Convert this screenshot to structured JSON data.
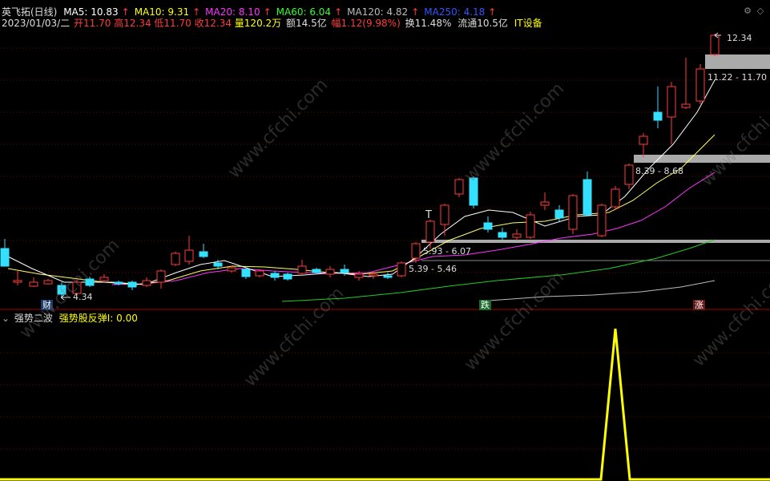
{
  "header": {
    "stock_name": "英飞拓(日线)",
    "ma": [
      {
        "label": "MA5: 10.83",
        "color": "#ffffff"
      },
      {
        "label": "MA10: 9.31",
        "color": "#ffff00"
      },
      {
        "label": "MA20: 8.10",
        "color": "#ff33ff"
      },
      {
        "label": "MA60: 6.04",
        "color": "#33ff33"
      },
      {
        "label": "MA120: 4.82",
        "color": "#bbbbbb"
      },
      {
        "label": "MA250: 4.18",
        "color": "#3355ff"
      }
    ],
    "ma_arrow": "↑"
  },
  "info": {
    "date": "2023/01/03/二",
    "open": "开11.70",
    "high": "高12.34",
    "low": "低11.70",
    "close": "收12.34",
    "volume": "量120.2万",
    "amount": "额14.5亿",
    "change": "幅1.12(9.98%)",
    "turnover": "换11.48%",
    "float": "流通10.5亿",
    "sector": "IT设备"
  },
  "price_annotations": {
    "high_label": "12.34",
    "low_label": "4.34",
    "zone1": "11.22 - 11.70",
    "zone2": "8.39 - 8.68",
    "zone3": "5.93 - 6.07",
    "zone4": "5.39 - 5.46",
    "t_marker": "T"
  },
  "tags": {
    "cai": "财",
    "die": "跌",
    "zhang": "涨"
  },
  "indicator": {
    "name": "强势二波",
    "series_label": "强势股反弹I: 0.00",
    "series_color": "#ffff00"
  },
  "watermark": "www.cfchi.com",
  "colors": {
    "up": "#ff3b3b",
    "down": "#33e0ff",
    "background": "#000000",
    "grid": "#8b0000"
  }
}
